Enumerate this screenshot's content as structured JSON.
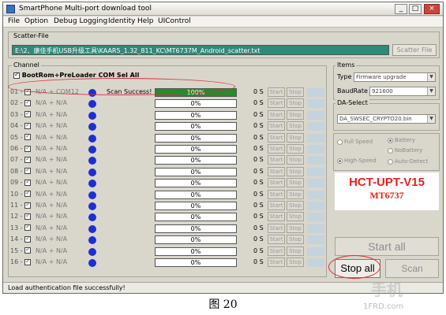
{
  "window": {
    "title": "SmartPhone Multi-port download tool",
    "controls": [
      "_",
      "□",
      "×"
    ]
  },
  "menu": [
    "File",
    "Option",
    "Debug Logging",
    "Identity",
    "Help",
    "UIControl"
  ],
  "scatter": {
    "label": "Scatter-File",
    "path": "E:\\2、康佳手机USB升级工具\\KAAR5_1.32_811_KC\\MT6737M_Android_scatter.txt",
    "button": "Scatter File"
  },
  "channel": {
    "label": "Channel",
    "bootrom_label": "BootRom+PreLoader COM Sel All",
    "bootrom_checked": true,
    "rows": [
      {
        "idx": "01",
        "comp": "N/A + COM12",
        "status": "Scan Success!",
        "progress": "100%",
        "fill": 1.0,
        "time": "0 S",
        "start": "Start",
        "stop": "Stop"
      },
      {
        "idx": "02",
        "comp": "N/A + N/A",
        "status": "",
        "progress": "0%",
        "fill": 0,
        "time": "0 S",
        "start": "Start",
        "stop": "Stop"
      },
      {
        "idx": "03",
        "comp": "N/A + N/A",
        "status": "",
        "progress": "0%",
        "fill": 0,
        "time": "0 S",
        "start": "Start",
        "stop": "Stop"
      },
      {
        "idx": "04",
        "comp": "N/A + N/A",
        "status": "",
        "progress": "0%",
        "fill": 0,
        "time": "0 S",
        "start": "Start",
        "stop": "Stop"
      },
      {
        "idx": "05",
        "comp": "N/A + N/A",
        "status": "",
        "progress": "0%",
        "fill": 0,
        "time": "0 S",
        "start": "Start",
        "stop": "Stop"
      },
      {
        "idx": "06",
        "comp": "N/A + N/A",
        "status": "",
        "progress": "0%",
        "fill": 0,
        "time": "0 S",
        "start": "Start",
        "stop": "Stop"
      },
      {
        "idx": "07",
        "comp": "N/A + N/A",
        "status": "",
        "progress": "0%",
        "fill": 0,
        "time": "0 S",
        "start": "Start",
        "stop": "Stop"
      },
      {
        "idx": "08",
        "comp": "N/A + N/A",
        "status": "",
        "progress": "0%",
        "fill": 0,
        "time": "0 S",
        "start": "Start",
        "stop": "Stop"
      },
      {
        "idx": "09",
        "comp": "N/A + N/A",
        "status": "",
        "progress": "0%",
        "fill": 0,
        "time": "0 S",
        "start": "Start",
        "stop": "Stop"
      },
      {
        "idx": "10",
        "comp": "N/A + N/A",
        "status": "",
        "progress": "0%",
        "fill": 0,
        "time": "0 S",
        "start": "Start",
        "stop": "Stop"
      },
      {
        "idx": "11",
        "comp": "N/A + N/A",
        "status": "",
        "progress": "0%",
        "fill": 0,
        "time": "0 S",
        "start": "Start",
        "stop": "Stop"
      },
      {
        "idx": "12",
        "comp": "N/A + N/A",
        "status": "",
        "progress": "0%",
        "fill": 0,
        "time": "0 S",
        "start": "Start",
        "stop": "Stop"
      },
      {
        "idx": "13",
        "comp": "N/A + N/A",
        "status": "",
        "progress": "0%",
        "fill": 0,
        "time": "0 S",
        "start": "Start",
        "stop": "Stop"
      },
      {
        "idx": "14",
        "comp": "N/A + N/A",
        "status": "",
        "progress": "0%",
        "fill": 0,
        "time": "0 S",
        "start": "Start",
        "stop": "Stop"
      },
      {
        "idx": "15",
        "comp": "N/A + N/A",
        "status": "",
        "progress": "0%",
        "fill": 0,
        "time": "0 S",
        "start": "Start",
        "stop": "Stop"
      },
      {
        "idx": "16",
        "comp": "N/A + N/A",
        "status": "",
        "progress": "0%",
        "fill": 0,
        "time": "0 S",
        "start": "Start",
        "stop": "Stop"
      }
    ]
  },
  "items": {
    "label": "Items",
    "type_label": "Type",
    "type_value": "Firmware upgrade",
    "baud_label": "BaudRate",
    "baud_value": "921600"
  },
  "da": {
    "label": "DA-Select",
    "value": "DA_SWSEC_CRYPTO20.bin"
  },
  "options": {
    "full_speed": "Full Speed",
    "high_speed": "High-Speed",
    "battery": "Battery",
    "no_battery": "NoBattery",
    "auto_detect": "Auto-Detect"
  },
  "brand": {
    "title": "HCT-UPT-V15",
    "model": "MT6737"
  },
  "buttons": {
    "start_all": "Start all",
    "stop_all": "Stop all",
    "scan": "Scan"
  },
  "status": {
    "text": "Load authentication file successfully!"
  },
  "figure": {
    "caption": "图 20",
    "watermark": "手机",
    "source": "1FRD.com"
  },
  "colors": {
    "progress_fill": "#278a2c",
    "dot": "#1d2fd0",
    "scatter_field": "#2f8a78",
    "brand": "#e0241b",
    "annotation": "#d8303a"
  }
}
